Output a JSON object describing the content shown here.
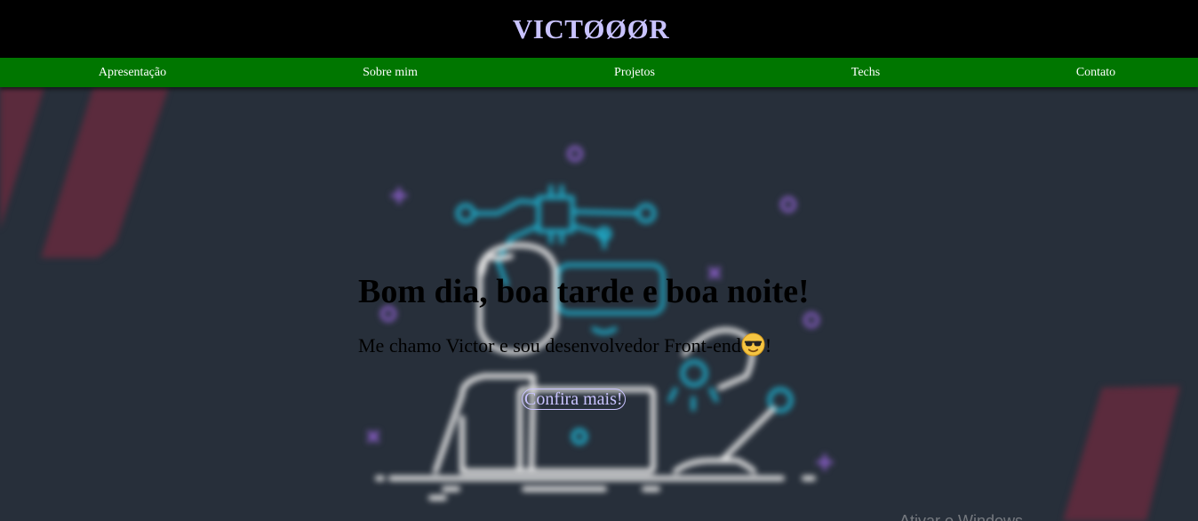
{
  "header": {
    "brand": "VICTØØØR"
  },
  "nav": {
    "items": [
      "Apresentação",
      "Sobre mim",
      "Projetos",
      "Techs",
      "Contato"
    ]
  },
  "hero": {
    "title": "Bom dia, boa tarde e boa noite!",
    "subtitle_before": "Me chamo Victor e sou desenvolvedor Front-end",
    "emoji_icon": "sunglasses-face-icon",
    "subtitle_after": "!",
    "cta_label": "Confira mais!"
  },
  "overlay": {
    "watermark": "Ativar o Windows"
  },
  "colors": {
    "topbar": "#000000",
    "brand": "#c9c3ff",
    "nav": "#007600",
    "background": "#272f3a",
    "accent_red": "#5b2b3d",
    "illustration_line": "#e6e6e6",
    "illustration_cyan": "#1fa7c4",
    "illustration_purple": "#8a5fc8",
    "cta": "#c9c3ff"
  }
}
